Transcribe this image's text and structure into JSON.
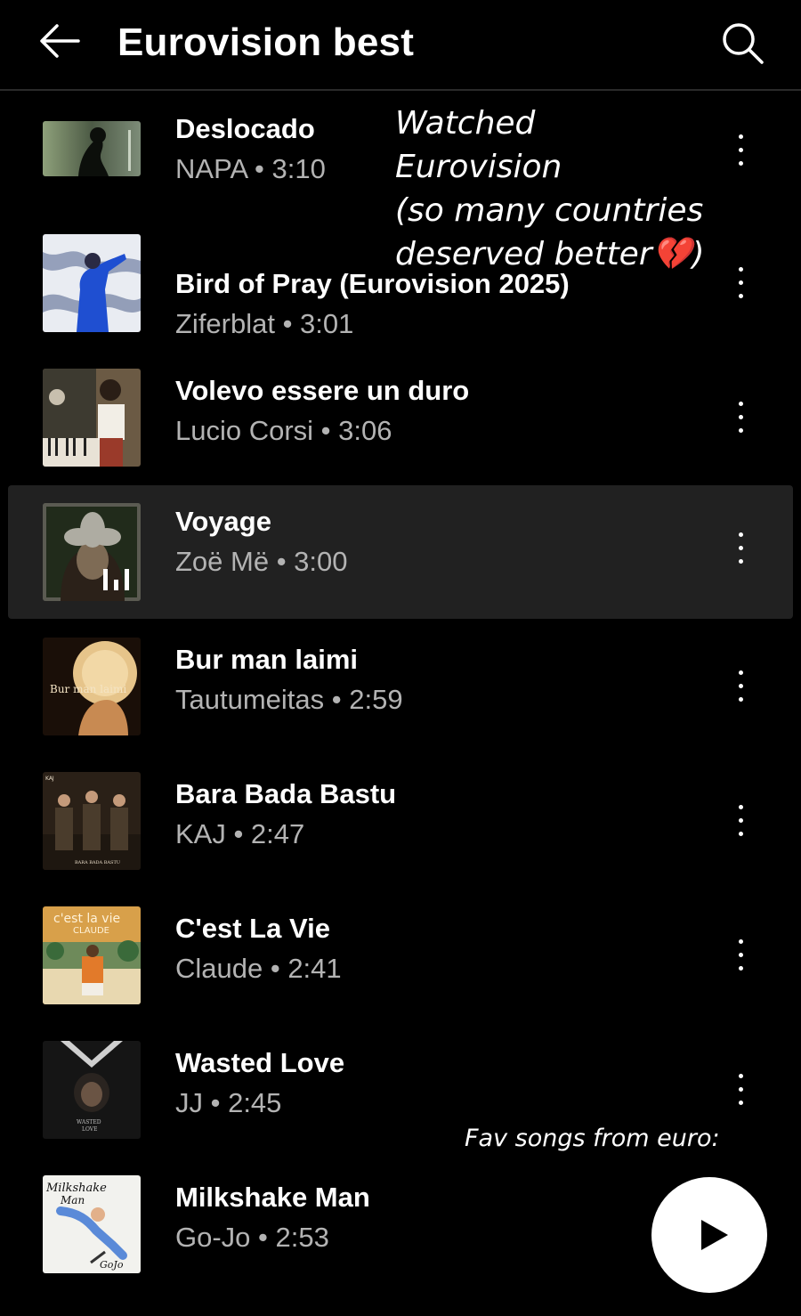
{
  "header": {
    "title": "Eurovision best",
    "back_icon": "arrow-left-icon",
    "search_icon": "search-icon"
  },
  "tracks": [
    {
      "title": "Deslocado",
      "subtitle": "NAPA • 3:10",
      "playing": false
    },
    {
      "title": "Bird of Pray (Eurovision 2025)",
      "subtitle": "Ziferblat • 3:01",
      "playing": false
    },
    {
      "title": "Volevo essere un duro",
      "subtitle": "Lucio Corsi • 3:06",
      "playing": false
    },
    {
      "title": "Voyage",
      "subtitle": "Zoë Më • 3:00",
      "playing": true
    },
    {
      "title": "Bur man laimi",
      "subtitle": "Tautumeitas • 2:59",
      "playing": false
    },
    {
      "title": "Bara Bada Bastu",
      "subtitle": "KAJ • 2:47",
      "playing": false
    },
    {
      "title": "C'est La Vie",
      "subtitle": "Claude • 2:41",
      "playing": false
    },
    {
      "title": "Wasted Love",
      "subtitle": "JJ • 2:45",
      "playing": false
    },
    {
      "title": "Milkshake Man",
      "subtitle": "Go-Jo • 2:53",
      "playing": false
    }
  ],
  "album_art_text": {
    "bur_man_laimi": "Bur man laimi",
    "kaj_top": "KAJ",
    "kaj_bottom": "BARA BADA BASTU",
    "cest_la_vie": "c'est la vie",
    "claude": "CLAUDE",
    "wasted_love_1": "WASTED",
    "wasted_love_2": "LOVE",
    "milkshake_1": "Milkshake",
    "milkshake_2": "Man",
    "gojo": "GoJo"
  },
  "annotations": {
    "top_note": "Watched Eurovision\n(so many countries\ndeserved better💔)",
    "bottom_note": "Fav songs from euro:"
  },
  "player": {
    "play_icon": "play-icon"
  },
  "colors": {
    "background": "#000000",
    "playing_row": "#212121",
    "subtitle": "#b3b3b3",
    "fab": "#ffffff"
  }
}
